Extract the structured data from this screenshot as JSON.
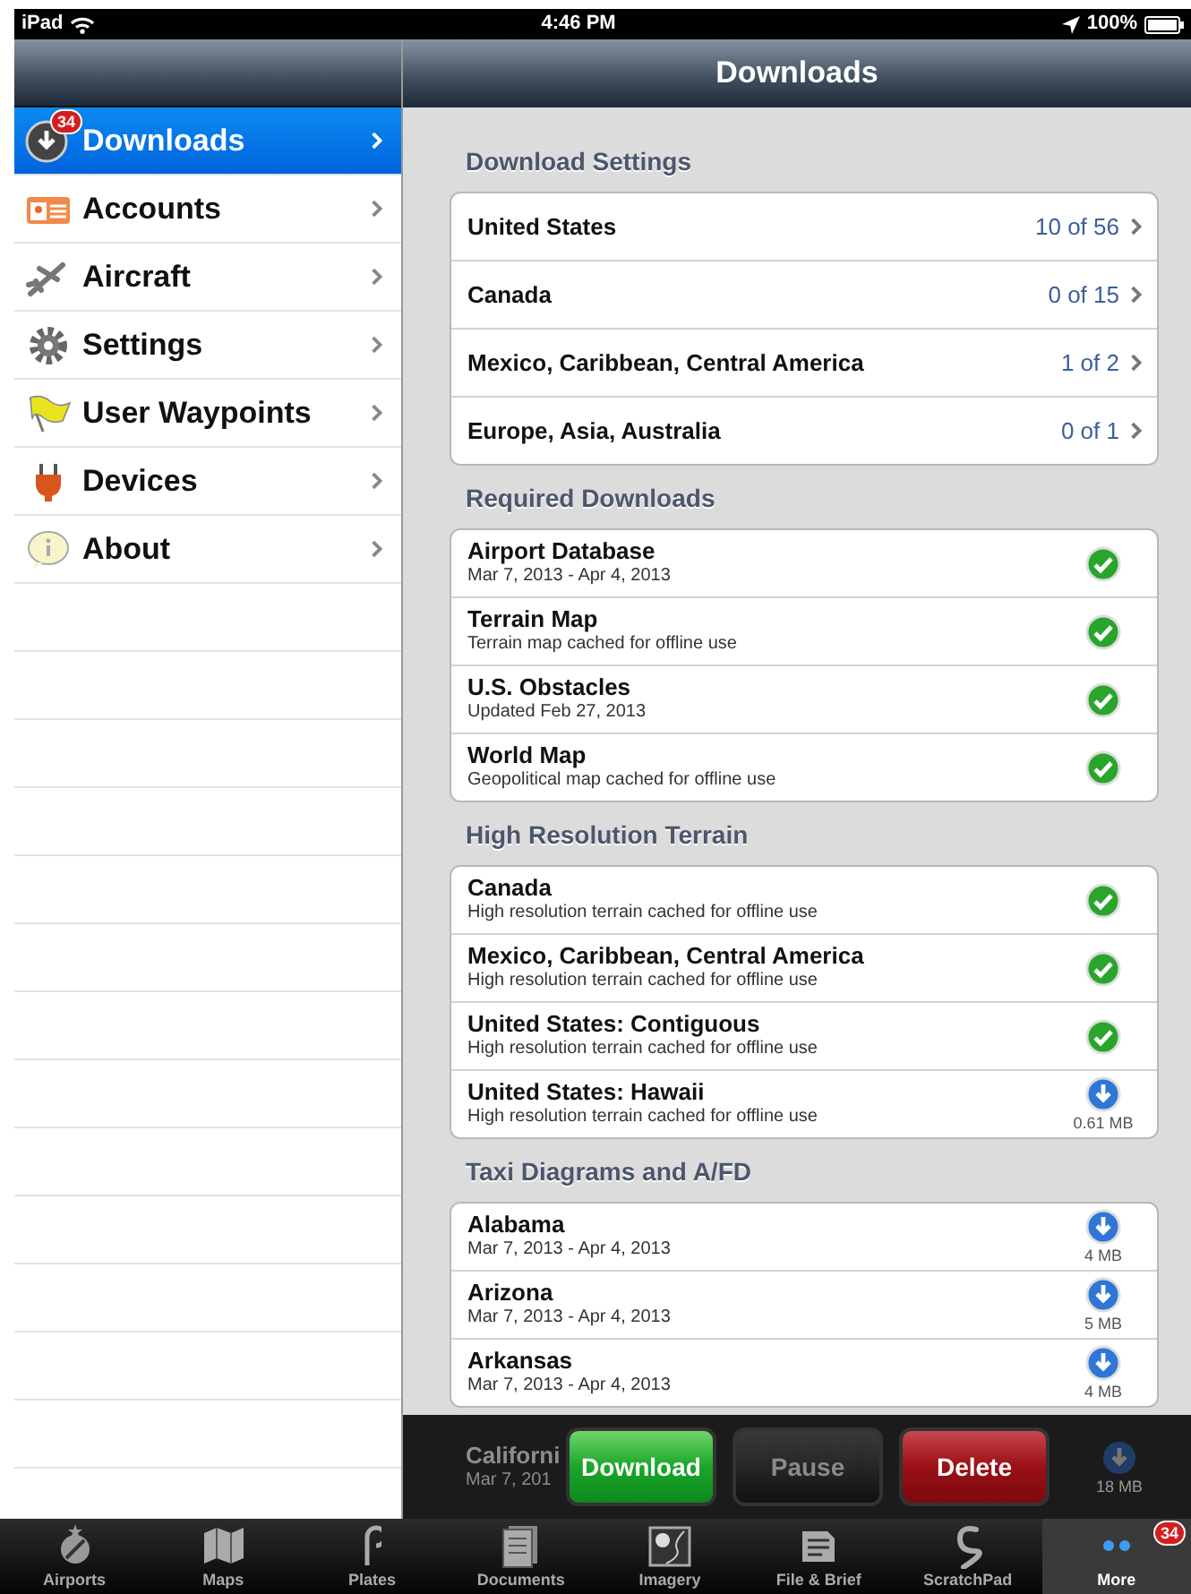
{
  "status_bar": {
    "device": "iPad",
    "time": "4:46 PM",
    "battery": "100%"
  },
  "sidebar": {
    "items": [
      {
        "label": "Downloads",
        "badge": "34",
        "selected": true
      },
      {
        "label": "Accounts",
        "selected": false
      },
      {
        "label": "Aircraft",
        "selected": false
      },
      {
        "label": "Settings",
        "selected": false
      },
      {
        "label": "User Waypoints",
        "selected": false
      },
      {
        "label": "Devices",
        "selected": false
      },
      {
        "label": "About",
        "selected": false
      }
    ]
  },
  "header": {
    "title": "Downloads"
  },
  "sections": [
    {
      "title": "Download Settings",
      "kind": "settings",
      "rows": [
        {
          "label": "United States",
          "value": "10 of 56"
        },
        {
          "label": "Canada",
          "value": "0 of 15"
        },
        {
          "label": "Mexico, Caribbean, Central America",
          "value": "1 of 2"
        },
        {
          "label": "Europe, Asia, Australia",
          "value": "0 of 1"
        }
      ]
    },
    {
      "title": "Required Downloads",
      "kind": "items",
      "rows": [
        {
          "label": "Airport Database",
          "detail": "Mar 7, 2013 - Apr 4, 2013",
          "kind": "done"
        },
        {
          "label": "Terrain Map",
          "detail": "Terrain map cached for offline use",
          "kind": "done"
        },
        {
          "label": "U.S. Obstacles",
          "detail": "Updated Feb 27, 2013",
          "kind": "done"
        },
        {
          "label": "World Map",
          "detail": "Geopolitical map cached for offline use",
          "kind": "done"
        }
      ]
    },
    {
      "title": "High Resolution Terrain",
      "kind": "items",
      "rows": [
        {
          "label": "Canada",
          "detail": "High resolution terrain cached for offline use",
          "kind": "done"
        },
        {
          "label": "Mexico, Caribbean, Central America",
          "detail": "High resolution terrain cached for offline use",
          "kind": "done"
        },
        {
          "label": "United States: Contiguous",
          "detail": "High resolution terrain cached for offline use",
          "kind": "done"
        },
        {
          "label": "United States: Hawaii",
          "detail": "High resolution terrain cached for offline use",
          "kind": "download",
          "size": "0.61 MB"
        }
      ]
    },
    {
      "title": "Taxi Diagrams and A/FD",
      "kind": "items",
      "rows": [
        {
          "label": "Alabama",
          "detail": "Mar 7, 2013 - Apr 4, 2013",
          "kind": "download",
          "size": "4 MB"
        },
        {
          "label": "Arizona",
          "detail": "Mar 7, 2013 - Apr 4, 2013",
          "kind": "download",
          "size": "5 MB"
        },
        {
          "label": "Arkansas",
          "detail": "Mar 7, 2013 - Apr 4, 2013",
          "kind": "download",
          "size": "4 MB"
        }
      ]
    }
  ],
  "action_bar": {
    "row_behind": {
      "label": "Californi",
      "detail": "Mar 7, 201",
      "size": "18 MB"
    },
    "buttons": [
      {
        "label": "Download",
        "kind": "go",
        "disabled": false
      },
      {
        "label": "Pause",
        "kind": "neutral",
        "disabled": true
      },
      {
        "label": "Delete",
        "kind": "danger",
        "disabled": false
      }
    ]
  },
  "tab_bar": {
    "items": [
      {
        "label": "Airports",
        "selected": false
      },
      {
        "label": "Maps",
        "selected": false
      },
      {
        "label": "Plates",
        "selected": false
      },
      {
        "label": "Documents",
        "selected": false
      },
      {
        "label": "Imagery",
        "selected": false
      },
      {
        "label": "File & Brief",
        "selected": false
      },
      {
        "label": "ScratchPad",
        "selected": false
      },
      {
        "label": "More",
        "badge": "34",
        "selected": true
      }
    ]
  }
}
